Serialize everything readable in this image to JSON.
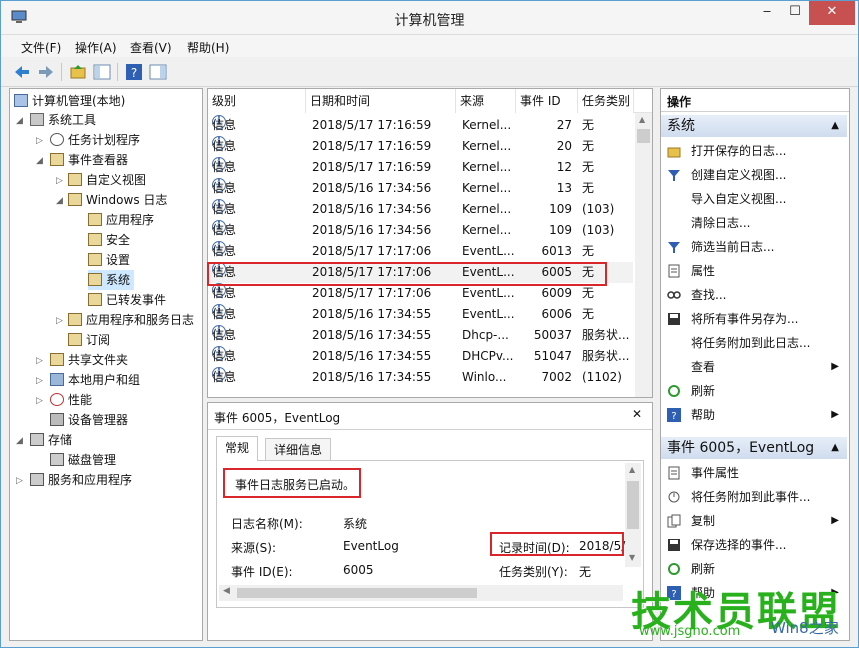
{
  "window": {
    "title": "计算机管理",
    "minimize": "‒",
    "maximize": "☐",
    "close": "✕"
  },
  "menu": [
    "文件(F)",
    "操作(A)",
    "查看(V)",
    "帮助(H)"
  ],
  "tree": {
    "root": "计算机管理(本地)",
    "items": [
      {
        "label": "系统工具"
      },
      {
        "label": "任务计划程序"
      },
      {
        "label": "事件查看器"
      },
      {
        "label": "自定义视图"
      },
      {
        "label": "Windows 日志"
      },
      {
        "label": "应用程序"
      },
      {
        "label": "安全"
      },
      {
        "label": "设置"
      },
      {
        "label": "系统"
      },
      {
        "label": "已转发事件"
      },
      {
        "label": "应用程序和服务日志"
      },
      {
        "label": "订阅"
      },
      {
        "label": "共享文件夹"
      },
      {
        "label": "本地用户和组"
      },
      {
        "label": "性能"
      },
      {
        "label": "设备管理器"
      },
      {
        "label": "存储"
      },
      {
        "label": "磁盘管理"
      },
      {
        "label": "服务和应用程序"
      }
    ]
  },
  "events": {
    "columns": [
      "级别",
      "日期和时间",
      "来源",
      "事件 ID",
      "任务类别"
    ],
    "rows": [
      {
        "level": "信息",
        "datetime": "2018/5/17 17:16:59",
        "source": "Kernel...",
        "id": "27",
        "category": "无"
      },
      {
        "level": "信息",
        "datetime": "2018/5/17 17:16:59",
        "source": "Kernel...",
        "id": "20",
        "category": "无"
      },
      {
        "level": "信息",
        "datetime": "2018/5/17 17:16:59",
        "source": "Kernel...",
        "id": "12",
        "category": "无"
      },
      {
        "level": "信息",
        "datetime": "2018/5/16 17:34:56",
        "source": "Kernel...",
        "id": "13",
        "category": "无"
      },
      {
        "level": "信息",
        "datetime": "2018/5/16 17:34:56",
        "source": "Kernel...",
        "id": "109",
        "category": "(103)"
      },
      {
        "level": "信息",
        "datetime": "2018/5/16 17:34:56",
        "source": "Kernel...",
        "id": "109",
        "category": "(103)"
      },
      {
        "level": "信息",
        "datetime": "2018/5/17 17:17:06",
        "source": "EventL...",
        "id": "6013",
        "category": "无"
      },
      {
        "level": "信息",
        "datetime": "2018/5/17 17:17:06",
        "source": "EventL...",
        "id": "6005",
        "category": "无"
      },
      {
        "level": "信息",
        "datetime": "2018/5/17 17:17:06",
        "source": "EventL...",
        "id": "6009",
        "category": "无"
      },
      {
        "level": "信息",
        "datetime": "2018/5/16 17:34:55",
        "source": "EventL...",
        "id": "6006",
        "category": "无"
      },
      {
        "level": "信息",
        "datetime": "2018/5/16 17:34:55",
        "source": "Dhcp-...",
        "id": "50037",
        "category": "服务状..."
      },
      {
        "level": "信息",
        "datetime": "2018/5/16 17:34:55",
        "source": "DHCPv...",
        "id": "51047",
        "category": "服务状..."
      },
      {
        "level": "信息",
        "datetime": "2018/5/16 17:34:55",
        "source": "Winlo...",
        "id": "7002",
        "category": "(1102)"
      }
    ]
  },
  "detail": {
    "title": "事件 6005，EventLog",
    "close": "✕",
    "tabs": [
      "常规",
      "详细信息"
    ],
    "message": "事件日志服务已启动。",
    "log_name_label": "日志名称(M):",
    "log_name_value": "系统",
    "source_label": "来源(S):",
    "source_value": "EventLog",
    "recorded_label": "记录时间(D):",
    "recorded_value": "2018/5/",
    "event_id_label": "事件 ID(E):",
    "event_id_value": "6005",
    "task_label": "任务类别(Y):",
    "task_value": "无"
  },
  "actions": {
    "header": "操作",
    "section1": "系统",
    "items1": [
      {
        "label": "打开保存的日志...",
        "icon": "folder-open-icon",
        "arrow": ""
      },
      {
        "label": "创建自定义视图...",
        "icon": "filter-icon",
        "arrow": ""
      },
      {
        "label": "导入自定义视图...",
        "icon": "",
        "arrow": ""
      },
      {
        "label": "清除日志...",
        "icon": "",
        "arrow": ""
      },
      {
        "label": "筛选当前日志...",
        "icon": "filter-icon",
        "arrow": ""
      },
      {
        "label": "属性",
        "icon": "properties-icon",
        "arrow": ""
      },
      {
        "label": "查找...",
        "icon": "find-icon",
        "arrow": ""
      },
      {
        "label": "将所有事件另存为...",
        "icon": "save-icon",
        "arrow": ""
      },
      {
        "label": "将任务附加到此日志...",
        "icon": "",
        "arrow": ""
      },
      {
        "label": "查看",
        "icon": "",
        "arrow": "▶"
      },
      {
        "label": "刷新",
        "icon": "refresh-icon",
        "arrow": ""
      },
      {
        "label": "帮助",
        "icon": "help-icon",
        "arrow": "▶"
      }
    ],
    "section2": "事件 6005，EventLog",
    "items2": [
      {
        "label": "事件属性",
        "icon": "properties-icon",
        "arrow": ""
      },
      {
        "label": "将任务附加到此事件...",
        "icon": "task-icon",
        "arrow": ""
      },
      {
        "label": "复制",
        "icon": "copy-icon",
        "arrow": "▶"
      },
      {
        "label": "保存选择的事件...",
        "icon": "save-icon",
        "arrow": ""
      },
      {
        "label": "刷新",
        "icon": "refresh-icon",
        "arrow": ""
      },
      {
        "label": "帮助",
        "icon": "help-icon",
        "arrow": "▶"
      }
    ]
  },
  "watermark": {
    "brand": "技术员联盟",
    "url": "www.jsgho.com",
    "sub": "Win8之家"
  },
  "colors": {
    "highlight": "#d9262b",
    "accent": "#1d4e9c",
    "watermark": "#29b11d"
  }
}
